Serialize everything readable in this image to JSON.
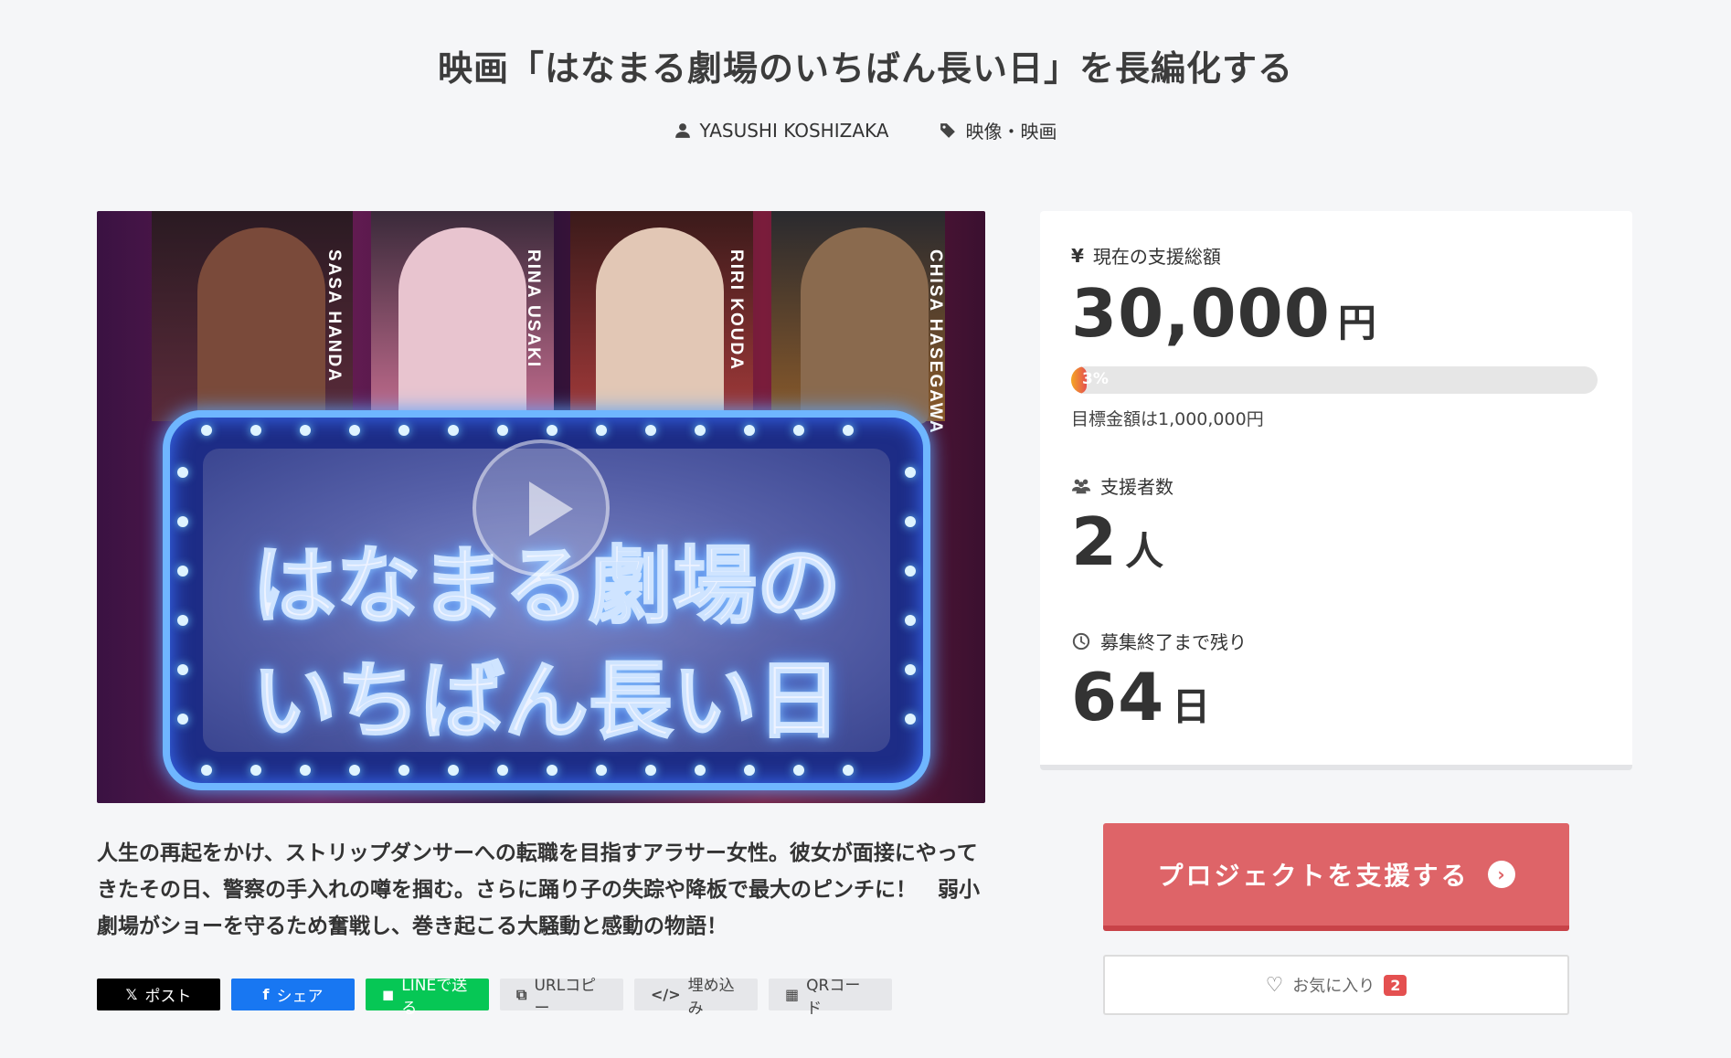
{
  "project": {
    "title": "映画「はなまる劇場のいちばん長い日」を長編化する",
    "author": "YASUSHI KOSHIZAKA",
    "category": "映像・映画"
  },
  "hero": {
    "names": [
      "SASA HANDA",
      "RINA USAKI",
      "RIRI KOUDA",
      "CHISA HASEGAWA"
    ],
    "title_line1": "はなまる劇場の",
    "title_line2": "いちばん長い日"
  },
  "description": "人生の再起をかけ、ストリップダンサーへの転職を目指すアラサー女性。彼女が面接にやってきたその日、警察の手入れの噂を掴む。さらに踊り子の失踪や降板で最大のピンチに！　弱小劇場がショーを守るため奮戦し、巻き起こる大騒動と感動の物語！",
  "share": {
    "x": "ポスト",
    "facebook": "シェア",
    "line": "LINEで送る",
    "url": "URLコピー",
    "embed": "埋め込み",
    "qr": "QRコード"
  },
  "stats": {
    "amount_label": "現在の支援総額",
    "amount_value": "30,000",
    "amount_unit": "円",
    "progress_percent": 3,
    "progress_text": "3%",
    "goal_text": "目標金額は1,000,000円",
    "supporters_label": "支援者数",
    "supporters_value": "2",
    "supporters_unit": "人",
    "remaining_label": "募集終了まで残り",
    "remaining_value": "64",
    "remaining_unit": "日"
  },
  "actions": {
    "support_label": "プロジェクトを支援する",
    "favorite_label": "お気に入り",
    "favorite_count": "2"
  },
  "colors": {
    "support": "#de6468",
    "facebook": "#1877f2",
    "line": "#06c755",
    "x": "#000000"
  }
}
